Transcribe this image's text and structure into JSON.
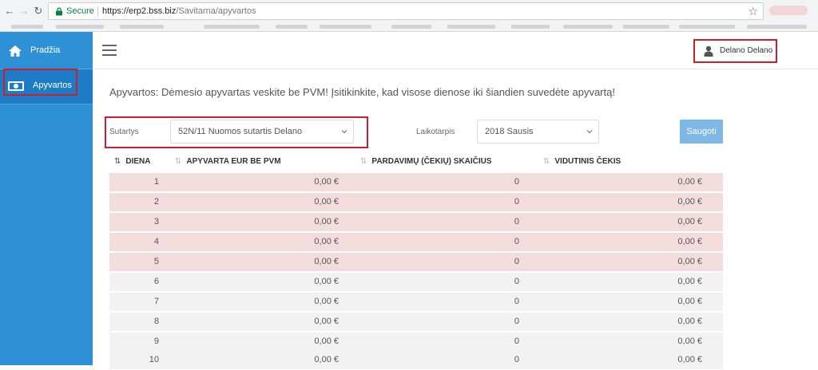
{
  "browser": {
    "secure_label": "Secure",
    "url_host": "https://erp2.bss.biz",
    "url_path": "/Savitarna/apyvartos"
  },
  "sidebar": {
    "items": [
      {
        "label": "Pradžia",
        "icon": "home-icon"
      },
      {
        "label": "Apyvartos",
        "icon": "money-icon",
        "active": true
      }
    ]
  },
  "header": {
    "user_name": "Delano Delano"
  },
  "main": {
    "notice": "Apyvartos: Dėmesio apyvartas veskite be PVM! Įsitikinkite, kad visose dienose iki šiandien suvedėte apyvartą!",
    "contract_label": "Sutartys",
    "contract_value": "52N/11 Nuomos sutartis Delano",
    "period_label": "Laikotarpis",
    "period_value": "2018 Sausis",
    "save_label": "Saugoti"
  },
  "table": {
    "headers": [
      "DIENA",
      "APYVARTA EUR BE PVM",
      "PARDAVIMŲ (ČEKIŲ) SKAIČIUS",
      "VIDUTINIS ČEKIS"
    ],
    "rows": [
      {
        "day": "1",
        "turnover": "0,00 €",
        "count": "0",
        "avg": "0,00 €",
        "highlight": true
      },
      {
        "day": "2",
        "turnover": "0,00 €",
        "count": "0",
        "avg": "0,00 €",
        "highlight": true
      },
      {
        "day": "3",
        "turnover": "0,00 €",
        "count": "0",
        "avg": "0,00 €",
        "highlight": true
      },
      {
        "day": "4",
        "turnover": "0,00 €",
        "count": "0",
        "avg": "0,00 €",
        "highlight": true
      },
      {
        "day": "5",
        "turnover": "0,00 €",
        "count": "0",
        "avg": "0,00 €",
        "highlight": true
      },
      {
        "day": "6",
        "turnover": "0,00 €",
        "count": "0",
        "avg": "0,00 €",
        "highlight": false
      },
      {
        "day": "7",
        "turnover": "0,00 €",
        "count": "0",
        "avg": "0,00 €",
        "highlight": false
      },
      {
        "day": "8",
        "turnover": "0,00 €",
        "count": "0",
        "avg": "0,00 €",
        "highlight": false
      },
      {
        "day": "9",
        "turnover": "0,00 €",
        "count": "0",
        "avg": "0,00 €",
        "highlight": false
      },
      {
        "day": "10",
        "turnover": "0,00 €",
        "count": "0",
        "avg": "0,00 €",
        "highlight": false
      }
    ]
  },
  "colors": {
    "sidebar": "#2f91d5",
    "highlight_row": "#f3dcde",
    "annotation_border": "#cc1f2d",
    "save_button": "#7fb8e4"
  }
}
